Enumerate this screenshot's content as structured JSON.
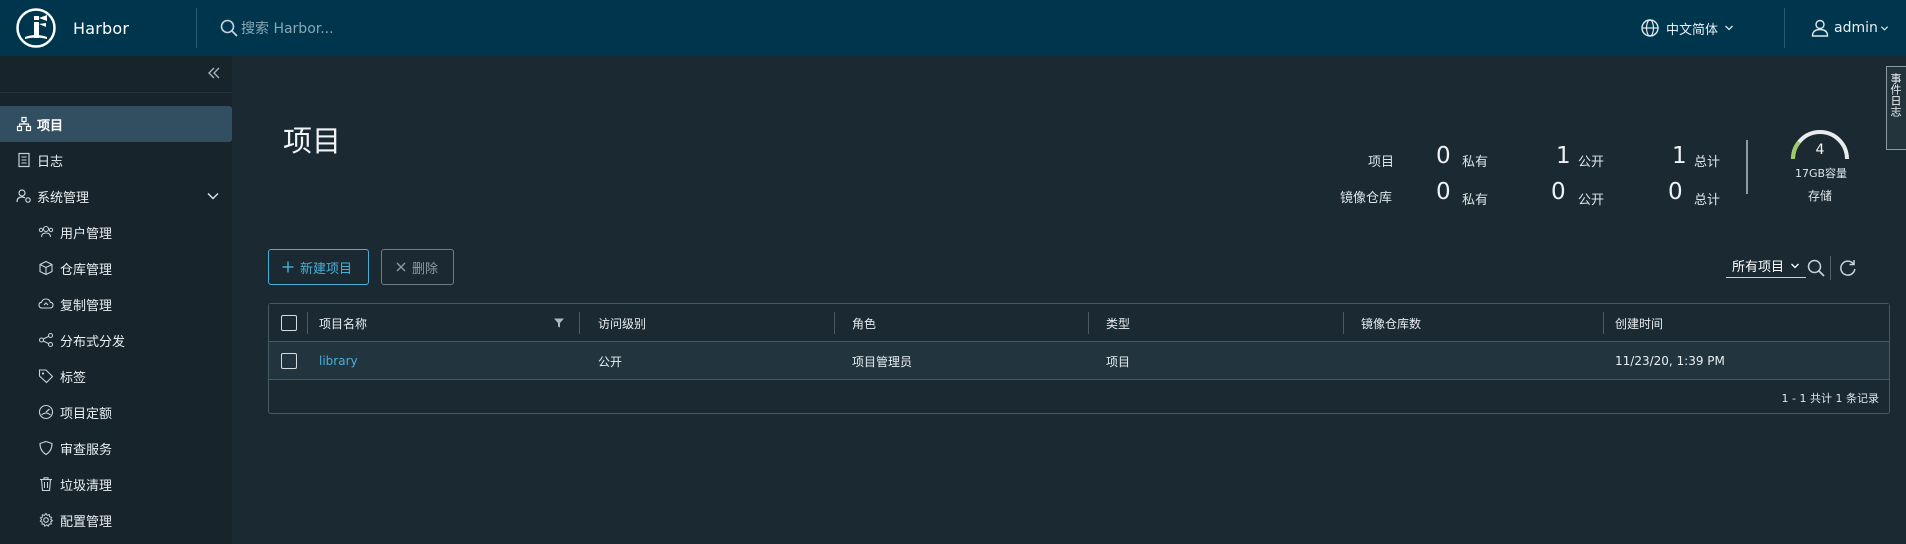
{
  "header": {
    "app_title": "Harbor",
    "search_placeholder": "搜索 Harbor...",
    "language": "中文简体",
    "username": "admin"
  },
  "sidebar": {
    "items": [
      {
        "label": "项目",
        "icon": "projects-icon",
        "active": true
      },
      {
        "label": "日志",
        "icon": "logs-icon"
      },
      {
        "label": "系统管理",
        "icon": "admin-icon",
        "expanded": true
      },
      {
        "label": "用户管理",
        "icon": "users-icon"
      },
      {
        "label": "仓库管理",
        "icon": "registry-icon"
      },
      {
        "label": "复制管理",
        "icon": "replication-icon"
      },
      {
        "label": "分布式分发",
        "icon": "distribution-icon"
      },
      {
        "label": "标签",
        "icon": "tag-icon"
      },
      {
        "label": "项目定额",
        "icon": "quota-icon"
      },
      {
        "label": "审查服务",
        "icon": "shield-icon"
      },
      {
        "label": "垃圾清理",
        "icon": "trash-icon"
      },
      {
        "label": "配置管理",
        "icon": "gear-icon"
      }
    ]
  },
  "main": {
    "title": "项目",
    "stats": {
      "projects_label": "项目",
      "repos_label": "镜像仓库",
      "private_label": "私有",
      "public_label": "公开",
      "total_label": "总计",
      "projects_private": "0",
      "projects_public": "1",
      "projects_total": "1",
      "repos_private": "0",
      "repos_public": "0",
      "repos_total": "0"
    },
    "storage": {
      "value": "4",
      "capacity": "17GB容量",
      "label": "存储"
    },
    "side_tab": "事件日志",
    "buttons": {
      "new_project": "新建项目",
      "delete": "删除"
    },
    "filter": {
      "selected": "所有项目"
    },
    "table": {
      "columns": [
        "项目名称",
        "访问级别",
        "角色",
        "类型",
        "镜像仓库数",
        "创建时间"
      ],
      "rows": [
        {
          "name": "library",
          "access": "公开",
          "role": "项目管理员",
          "type": "项目",
          "repo_count": "",
          "created": "11/23/20, 1:39 PM"
        }
      ],
      "footer": "1 - 1 共计 1 条记录"
    }
  },
  "colors": {
    "header_bg": "#00364d",
    "sidebar_bg": "#17242b",
    "content_bg": "#1b2a32",
    "active_item_bg": "#324f61",
    "accent": "#49afd9",
    "gauge": "#9ccc65"
  }
}
